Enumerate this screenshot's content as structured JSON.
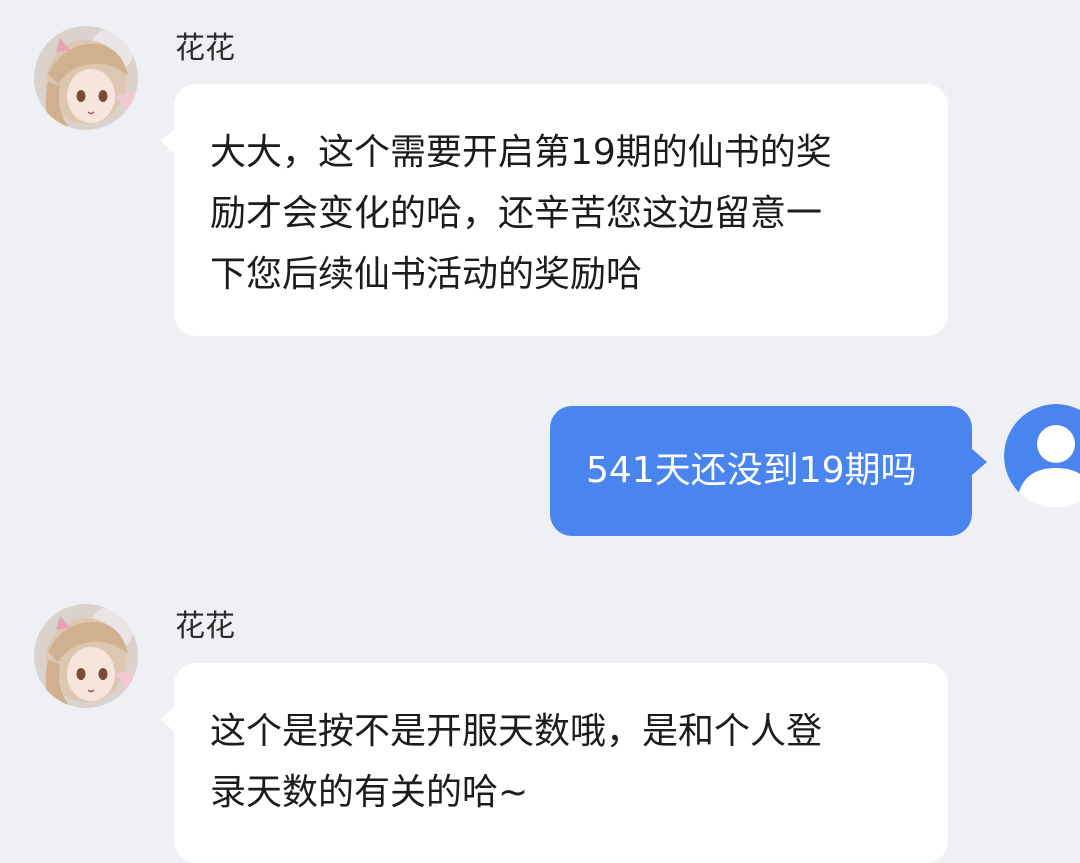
{
  "messages": [
    {
      "sender": "花花",
      "avatar_icon": "anime-girl-avatar-icon",
      "direction": "incoming",
      "text": "大大，这个需要开启第19期的仙书的奖\n励才会变化的哈，还辛苦您这边留意一\n下您后续仙书活动的奖励哈"
    },
    {
      "avatar_icon": "user-avatar-icon",
      "direction": "outgoing",
      "text": "541天还没到19期吗"
    },
    {
      "sender": "花花",
      "avatar_icon": "anime-girl-avatar-icon",
      "direction": "incoming",
      "text": "这个是按不是开服天数哦，是和个人登\n录天数的有关的哈~"
    }
  ],
  "colors": {
    "background": "#eef0f3",
    "incoming_bubble": "#ffffff",
    "outgoing_bubble": "#4a84ef",
    "user_avatar": "#4a84ef"
  }
}
